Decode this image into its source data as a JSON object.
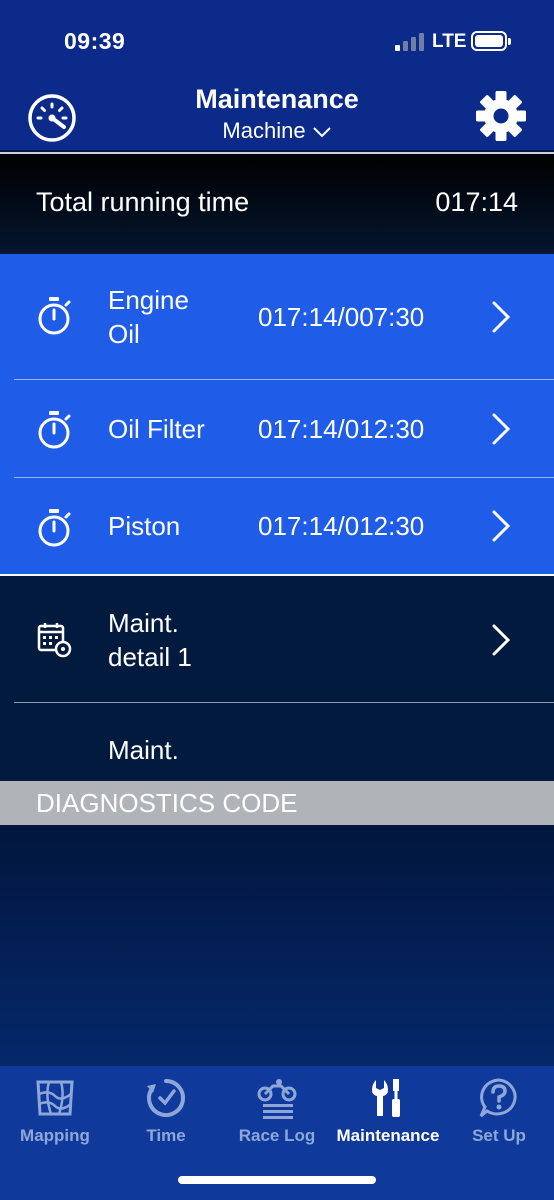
{
  "status_bar": {
    "time": "09:39",
    "network": "LTE",
    "signal_bars_active": 1,
    "signal_bars_total": 4
  },
  "header": {
    "title": "Maintenance",
    "subtitle": "Machine",
    "left_icon": "speedometer-icon",
    "right_icon": "gear-icon"
  },
  "total_running": {
    "label": "Total running time",
    "value": "017:14"
  },
  "timer_items": [
    {
      "label_line1": "Engine",
      "label_line2": "Oil",
      "value": "017:14/007:30",
      "icon": "stopwatch-icon"
    },
    {
      "label_line1": "Oil Filter",
      "label_line2": "",
      "value": "017:14/012:30",
      "icon": "stopwatch-icon"
    },
    {
      "label_line1": "Piston",
      "label_line2": "",
      "value": "017:14/012:30",
      "icon": "stopwatch-icon"
    }
  ],
  "detail_items": [
    {
      "label_line1": "Maint.",
      "label_line2": "detail 1",
      "icon": "calendar-gear-icon"
    },
    {
      "label_line1": "Maint.",
      "label_line2": ""
    }
  ],
  "diagnostics": {
    "label": "DIAGNOSTICS CODE"
  },
  "tabs": [
    {
      "label": "Mapping",
      "icon": "map-icon",
      "active": false
    },
    {
      "label": "Time",
      "icon": "clock-icon",
      "active": false
    },
    {
      "label": "Race Log",
      "icon": "motorcycle-icon",
      "active": false
    },
    {
      "label": "Maintenance",
      "icon": "wrench-icon",
      "active": true
    },
    {
      "label": "Set Up",
      "icon": "help-icon",
      "active": false
    }
  ],
  "colors": {
    "header_bg": "#0b2a8a",
    "row_blue": "#1f5ce8",
    "row_dark": "#021a3e",
    "diagnostics_bar": "#b0b4b9",
    "tab_inactive": "#8fa7d8"
  }
}
